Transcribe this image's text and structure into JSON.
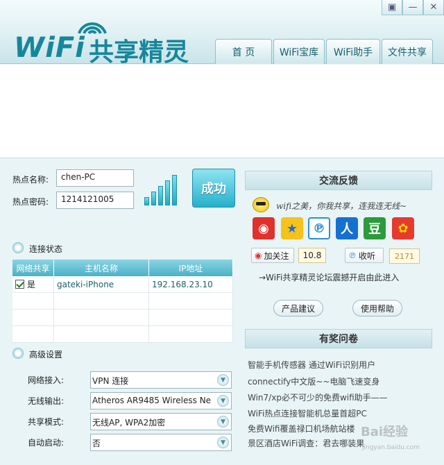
{
  "app": {
    "logo_wifi": "WiFi",
    "logo_cn": "共享精灵"
  },
  "window_buttons": [
    {
      "name": "skin-icon",
      "glyph": "▣"
    },
    {
      "name": "minimize-icon",
      "glyph": "—"
    },
    {
      "name": "close-icon",
      "glyph": "✕"
    }
  ],
  "tabs": [
    "首 页",
    "WiFi宝库",
    "WiFi助手",
    "文件共享"
  ],
  "hotspot": {
    "name_label": "热点名称:",
    "name_value": "chen-PC",
    "password_label": "热点密码:",
    "password_value": "1214121005",
    "status_button": "成功"
  },
  "connection": {
    "section_label": "连接状态",
    "columns": [
      "网络共享",
      "主机名称",
      "IP地址"
    ],
    "rows": [
      {
        "share": "是",
        "checked": true,
        "host": "gateki-iPhone",
        "ip": "192.168.23.10"
      },
      {
        "share": "",
        "checked": false,
        "host": "",
        "ip": ""
      },
      {
        "share": "",
        "checked": false,
        "host": "",
        "ip": ""
      },
      {
        "share": "",
        "checked": false,
        "host": "",
        "ip": ""
      }
    ]
  },
  "advanced": {
    "section_label": "高级设置",
    "network_label": "网络接入:",
    "network_value": "VPN 连接",
    "wireless_label": "无线输出:",
    "wireless_value": "Atheros AR9485 Wireless Ne",
    "mode_label": "共享模式:",
    "mode_value": "无线AP, WPA2加密",
    "autostart_label": "自动启动:",
    "autostart_value": "否"
  },
  "feedback": {
    "header": "交流反馈",
    "slogan": "wifi之美，你我共享，连我连无线~",
    "follow_weibo": "加关注",
    "follow_weibo_count": "10.8",
    "follow_tencent": "收听",
    "follow_tencent_count": "2171",
    "forum_link": "→WiFi共享精灵论坛震撼开启由此进入",
    "suggest_button": "产品建议",
    "help_button": "使用帮助"
  },
  "survey": {
    "header": "有奖问卷",
    "items": [
      "智能手机传感器 通过WiFi识别用户",
      "connectify中文版~~电脑飞速变身",
      "Win7/xp必不可少的免费wifi助手——",
      "WiFi热点连接智能机总量首超PC",
      "免费Wifi覆盖禄口机场航站楼",
      "景区酒店WiFi调查：君去哪装果"
    ]
  },
  "watermark": {
    "text": "Bai经验",
    "url": "jingyan.baidu.com"
  },
  "colors": {
    "accent": "#16879b",
    "table_header": "#4bb1c6",
    "success": "#26b0cc"
  }
}
